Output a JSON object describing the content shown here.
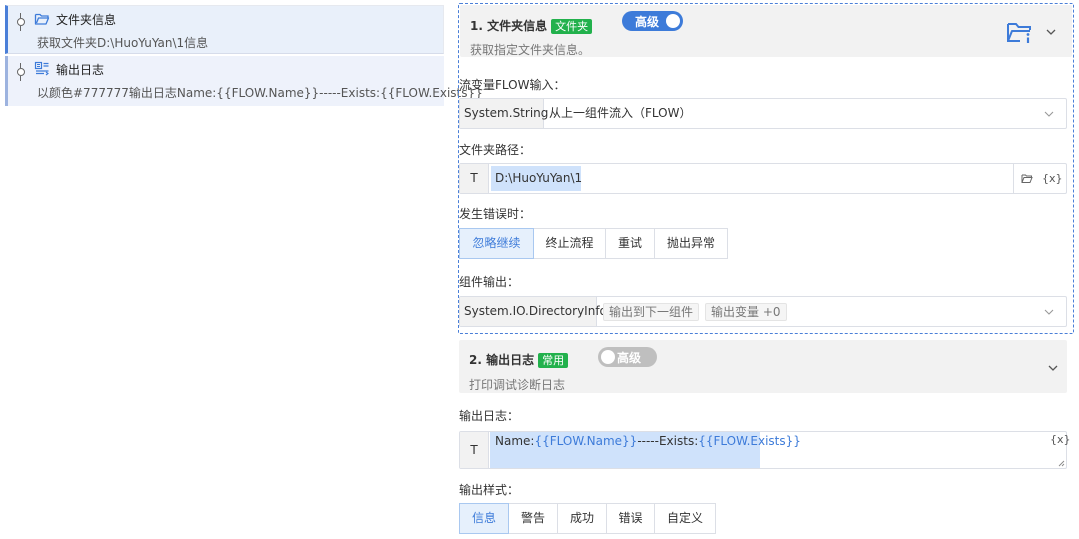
{
  "flow_list": [
    {
      "title": "文件夹信息",
      "subtitle": "获取文件夹D:\\HuoYuYan\\1信息",
      "icon": "folder-open-icon"
    },
    {
      "title": "输出日志",
      "subtitle": "以颜色#777777输出日志Name:{{FLOW.Name}}-----Exists:{{FLOW.Exists}}",
      "icon": "log-output-icon"
    }
  ],
  "card1": {
    "number_title": "1. 文件夹信息",
    "tag": "文件夹",
    "toggle_label": "高级",
    "toggle_on": true,
    "description": "获取指定文件夹信息。",
    "header_icon": "folder-info-icon",
    "flow_input": {
      "label": "流变量FLOW输入：",
      "type": "System.String",
      "value": "从上一组件流入（FLOW）"
    },
    "folder_path": {
      "label": "文件夹路径：",
      "prefix": "T",
      "value": "D:\\HuoYuYan\\1",
      "variable_button": "{x}"
    },
    "on_error": {
      "label": "发生错误时：",
      "options": [
        "忽略继续",
        "终止流程",
        "重试",
        "抛出异常"
      ],
      "selected": 0
    },
    "output": {
      "label": "组件输出：",
      "type": "System.IO.DirectoryInfo",
      "chips": [
        "输出到下一组件",
        "输出变量 +0"
      ]
    }
  },
  "card2": {
    "number_title": "2. 输出日志",
    "tag": "常用",
    "toggle_label": "高级",
    "toggle_on": false,
    "description": "打印调试诊断日志",
    "log": {
      "label": "输出日志：",
      "prefix": "T",
      "text_name": "Name:",
      "var_name": "{{FLOW.Name}}",
      "text_exists": "-----Exists:",
      "var_exists": "{{FLOW.Exists}}",
      "variable_button": "{x}"
    },
    "style": {
      "label": "输出样式：",
      "options": [
        "信息",
        "警告",
        "成功",
        "错误",
        "自定义"
      ],
      "selected": 0
    }
  },
  "colors": {
    "accent": "#3d7bd9",
    "tag_green": "#22b14c",
    "selected_bg": "#e9f0fa"
  }
}
